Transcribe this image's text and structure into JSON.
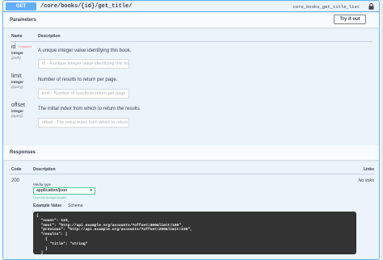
{
  "operation": {
    "method": "GET",
    "path": "/core/books/{id}/get_title/",
    "operation_id": "core_books_get_title_list"
  },
  "parameters_section": {
    "title": "Parameters",
    "try_button": "Try it out",
    "col_name": "Name",
    "col_description": "Description"
  },
  "params": [
    {
      "name": "id",
      "required_label": "* required",
      "type": "integer",
      "in": "(path)",
      "description": "A unique integer value identifying this book.",
      "placeholder": "id - A unique integer value identifying this book."
    },
    {
      "name": "limit",
      "type": "integer",
      "in": "(query)",
      "description": "Number of results to return per page.",
      "placeholder": "limit - Number of results to return per page."
    },
    {
      "name": "offset",
      "type": "integer",
      "in": "(query)",
      "description": "The initial index from which to return the results.",
      "placeholder": "offset - The initial index from which to return the results."
    }
  ],
  "responses_section": {
    "title": "Responses",
    "col_code": "Code",
    "col_description": "Description",
    "col_links": "Links"
  },
  "response": {
    "code": "200",
    "links": "No links",
    "media_type_label": "Media type",
    "media_type": "application/json",
    "controls_text": "Controls Accept header.",
    "tab_example": "Example Value",
    "tab_schema": "Schema",
    "example_lines": [
      "{",
      "  \"count\": 123,",
      "  \"next\": \"http://api.example.org/accounts/?offset=400&limit=100\",",
      "  \"previous\": \"http://api.example.org/accounts/?offset=200&limit=100\",",
      "  \"results\": [",
      "    {",
      "      \"title\": \"string\"",
      "    }",
      "  ]",
      "}"
    ]
  },
  "colors": {
    "get_blue": "#61affe",
    "background": "#ebf3fb",
    "success_green": "#49cc90",
    "required_red": "#ff6f6f"
  }
}
